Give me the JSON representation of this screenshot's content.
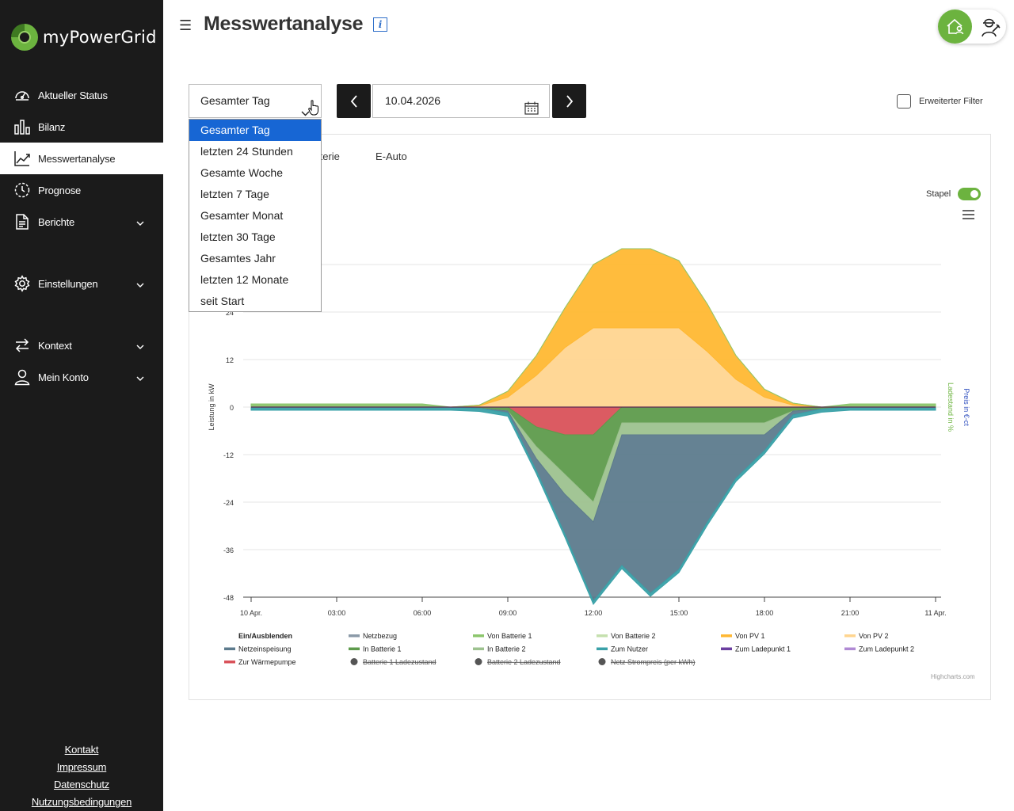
{
  "app": {
    "brand": "myPowerGrid"
  },
  "header": {
    "title": "Messwertanalyse"
  },
  "sidebar": {
    "items": [
      {
        "label": "Aktueller Status",
        "icon": "gauge-icon",
        "active": false,
        "expandable": false
      },
      {
        "label": "Bilanz",
        "icon": "bar-chart-icon",
        "active": false,
        "expandable": false
      },
      {
        "label": "Messwertanalyse",
        "icon": "line-chart-icon",
        "active": true,
        "expandable": false
      },
      {
        "label": "Prognose",
        "icon": "forecast-icon",
        "active": false,
        "expandable": false
      },
      {
        "label": "Berichte",
        "icon": "document-icon",
        "active": false,
        "expandable": true
      },
      {
        "label": "Einstellungen",
        "icon": "gear-icon",
        "active": false,
        "expandable": true
      },
      {
        "label": "Kontext",
        "icon": "swap-icon",
        "active": false,
        "expandable": true
      },
      {
        "label": "Mein Konto",
        "icon": "user-icon",
        "active": false,
        "expandable": true
      }
    ],
    "footer": [
      "Kontakt",
      "Impressum",
      "Datenschutz",
      "Nutzungsbedingungen"
    ]
  },
  "toolbar": {
    "range_value": "Gesamter Tag",
    "range_options": [
      "Gesamter Tag",
      "letzten 24 Stunden",
      "Gesamte Woche",
      "letzten 7 Tage",
      "Gesamter Monat",
      "letzten 30 Tage",
      "Gesamtes Jahr",
      "letzten 12 Monate",
      "seit Start"
    ],
    "date_value": "10.04.2026",
    "advanced_filter_label": "Erweiterter Filter"
  },
  "tabs": {
    "battery_partial": "tterie",
    "ecar": "E-Auto"
  },
  "stack_toggle": {
    "label": "Stapel",
    "on": true
  },
  "credit": "Highcharts.com",
  "colors": {
    "pv1": "#ffb833",
    "pv2": "#ffd590",
    "netzeinspeisung": "#5d7b8d",
    "in_batterie_1": "#5e9b4c",
    "in_batterie_2": "#9dc28f",
    "waermepumpe": "#d9525a",
    "zum_nutzer": "#3aa1a8",
    "netzbezug": "#8b9aa8",
    "ladepunkt_1": "#6b3fa0",
    "ladepunkt_2": "#b08ad4",
    "von_batterie_1": "#8cc66d",
    "von_batterie_2": "#c5e0ae",
    "accent": "#6cb33f",
    "selected": "#1766d4"
  },
  "chart_data": {
    "type": "area",
    "stacked": true,
    "ylabel": "Leistung in kW",
    "ylabel_right_1": "Ladestand in %",
    "ylabel_right_2": "Preis in €-ct",
    "ylim": [
      -48,
      48
    ],
    "y_ticks": [
      24,
      12,
      0,
      -12,
      -24,
      -36,
      -48
    ],
    "x_ticks": [
      "10 Apr.",
      "03:00",
      "06:00",
      "09:00",
      "12:00",
      "15:00",
      "18:00",
      "21:00",
      "11 Apr."
    ],
    "x": [
      "00:00",
      "01:00",
      "02:00",
      "03:00",
      "04:00",
      "05:00",
      "06:00",
      "07:00",
      "08:00",
      "09:00",
      "10:00",
      "11:00",
      "12:00",
      "13:00",
      "14:00",
      "15:00",
      "16:00",
      "17:00",
      "18:00",
      "19:00",
      "20:00",
      "21:00",
      "22:00",
      "23:00",
      "24:00"
    ],
    "series": [
      {
        "name": "Von PV 2",
        "values": [
          0,
          0,
          0,
          0,
          0,
          0,
          0,
          0,
          0.3,
          2.5,
          8,
          15,
          20,
          20,
          20,
          20,
          14,
          7,
          2.5,
          0.5,
          0,
          0,
          0,
          0,
          0
        ],
        "key": "pv2"
      },
      {
        "name": "Von PV 1",
        "values": [
          0,
          0,
          0,
          0,
          0,
          0,
          0,
          0,
          0.2,
          1.5,
          5,
          10,
          16,
          20,
          20,
          17,
          12,
          6,
          2,
          0.5,
          0,
          0,
          0,
          0,
          0
        ],
        "key": "pv1"
      },
      {
        "name": "Zur Wärmepumpe",
        "values": [
          0,
          0,
          0,
          0,
          0,
          0,
          0,
          0,
          0,
          0,
          -5,
          -7,
          -7,
          0,
          0,
          0,
          0,
          0,
          0,
          0,
          0,
          0,
          0,
          0,
          0
        ],
        "key": "waermepumpe"
      },
      {
        "name": "In Batterie 1",
        "values": [
          0,
          0,
          0,
          0,
          0,
          0,
          0,
          0,
          -0.3,
          -1,
          -5,
          -10,
          -17,
          -4,
          -4,
          -4,
          -4,
          -4,
          -4,
          -1,
          -0.5,
          0,
          0,
          0,
          0
        ],
        "key": "in_batterie_1"
      },
      {
        "name": "In Batterie 2",
        "values": [
          0,
          0,
          0,
          0,
          0,
          0,
          0,
          0,
          0,
          0,
          -3,
          -5,
          -5,
          -3,
          -3,
          -3,
          -3,
          -3,
          -3,
          0,
          0,
          0,
          0,
          0,
          0
        ],
        "key": "in_batterie_2"
      },
      {
        "name": "Netzeinspeisung",
        "values": [
          0,
          0,
          0,
          0,
          0,
          0,
          0,
          0,
          0,
          -0.5,
          -3,
          -10,
          -20,
          -33,
          -40,
          -34,
          -22,
          -11,
          -4,
          -1,
          0,
          0,
          0,
          0,
          0
        ],
        "key": "netzeinspeisung"
      },
      {
        "name": "Zum Nutzer",
        "values": [
          -0.8,
          -0.8,
          -0.8,
          -0.8,
          -0.8,
          -0.8,
          -0.8,
          -0.8,
          -0.8,
          -0.8,
          -0.8,
          -0.8,
          -0.8,
          -0.8,
          -0.8,
          -0.8,
          -0.8,
          -0.8,
          -0.8,
          -0.8,
          -0.8,
          -0.8,
          -0.8,
          -0.8,
          -0.8
        ],
        "key": "zum_nutzer"
      },
      {
        "name": "Von Batterie 1",
        "values": [
          0.8,
          0.8,
          0.8,
          0.8,
          0.8,
          0.8,
          0.8,
          0,
          0,
          0,
          0,
          0,
          0,
          0,
          0,
          0,
          0,
          0,
          0,
          0,
          0,
          0.8,
          0.8,
          0.8,
          0.8
        ],
        "key": "von_batterie_1"
      }
    ],
    "legend": {
      "toggle_label": "Ein/Ausblenden",
      "items": [
        {
          "name": "Netzbezug",
          "key": "netzbezug",
          "hidden": false,
          "marker": "line"
        },
        {
          "name": "Von Batterie 1",
          "key": "von_batterie_1",
          "hidden": false,
          "marker": "line"
        },
        {
          "name": "Von Batterie 2",
          "key": "von_batterie_2",
          "hidden": false,
          "marker": "line"
        },
        {
          "name": "Von PV 1",
          "key": "pv1",
          "hidden": false,
          "marker": "line"
        },
        {
          "name": "Von PV 2",
          "key": "pv2",
          "hidden": false,
          "marker": "line"
        },
        {
          "name": "Netzeinspeisung",
          "key": "netzeinspeisung",
          "hidden": false,
          "marker": "line"
        },
        {
          "name": "In Batterie 1",
          "key": "in_batterie_1",
          "hidden": false,
          "marker": "line"
        },
        {
          "name": "In Batterie 2",
          "key": "in_batterie_2",
          "hidden": false,
          "marker": "line"
        },
        {
          "name": "Zum Nutzer",
          "key": "zum_nutzer",
          "hidden": false,
          "marker": "line"
        },
        {
          "name": "Zum Ladepunkt 1",
          "key": "ladepunkt_1",
          "hidden": false,
          "marker": "line"
        },
        {
          "name": "Zum Ladepunkt 2",
          "key": "ladepunkt_2",
          "hidden": false,
          "marker": "line"
        },
        {
          "name": "Zur Wärmepumpe",
          "key": "waermepumpe",
          "hidden": false,
          "marker": "line"
        },
        {
          "name": "Batterie 1 Ladezustand",
          "key": "soc1",
          "hidden": true,
          "marker": "dot"
        },
        {
          "name": "Batterie 2 Ladezustand",
          "key": "soc2",
          "hidden": true,
          "marker": "dot"
        },
        {
          "name": "Netz Strompreis (per kWh)",
          "key": "price",
          "hidden": true,
          "marker": "dot"
        }
      ]
    }
  }
}
